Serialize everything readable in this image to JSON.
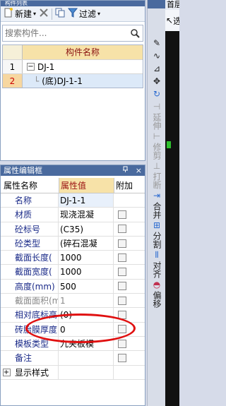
{
  "list_panel": {
    "title": "构件列表",
    "toolbar": {
      "new_label": "新建",
      "filter_label": "过滤"
    },
    "search": {
      "placeholder": "搜索构件..."
    },
    "grid": {
      "header": "构件名称",
      "rows": [
        {
          "num": "1",
          "name": "DJ-1",
          "expander": "−"
        },
        {
          "num": "2",
          "name": "(底)DJ-1-1"
        }
      ]
    }
  },
  "prop_panel": {
    "title": "属性编辑框",
    "pin": "ᵃ",
    "close": "×",
    "headers": {
      "name": "属性名称",
      "value": "属性值",
      "add": "附加"
    },
    "rows": [
      {
        "name": "名称",
        "value": "DJ-1-1"
      },
      {
        "name": "材质",
        "value": "现浇混凝"
      },
      {
        "name": "砼标号",
        "value": "(C35)"
      },
      {
        "name": "砼类型",
        "value": "(碎石混凝"
      },
      {
        "name": "截面长度(",
        "value": "1000"
      },
      {
        "name": "截面宽度(",
        "value": "1000"
      },
      {
        "name": "高度(mm)",
        "value": "500"
      },
      {
        "name": "截面面积(m",
        "value": "1"
      },
      {
        "name": "相对底标高",
        "value": "(0)"
      },
      {
        "name": "砖胎膜厚度",
        "value": "0"
      },
      {
        "name": "模板类型",
        "value": "九夹板模"
      },
      {
        "name": "备注",
        "value": ""
      },
      {
        "name": "显示样式",
        "value": "",
        "expander": "+"
      }
    ]
  },
  "right_toolbar": {
    "items": [
      "延伸",
      "修剪",
      "打断",
      "合并",
      "分割",
      "对齐",
      "偏移"
    ]
  },
  "right_strip": {
    "top_label": "首层",
    "select_label": "选择"
  },
  "colors": {
    "title_bar": "#4a6a9e",
    "header_yellow": "#f7e2a8",
    "annotation": "#e01010"
  }
}
